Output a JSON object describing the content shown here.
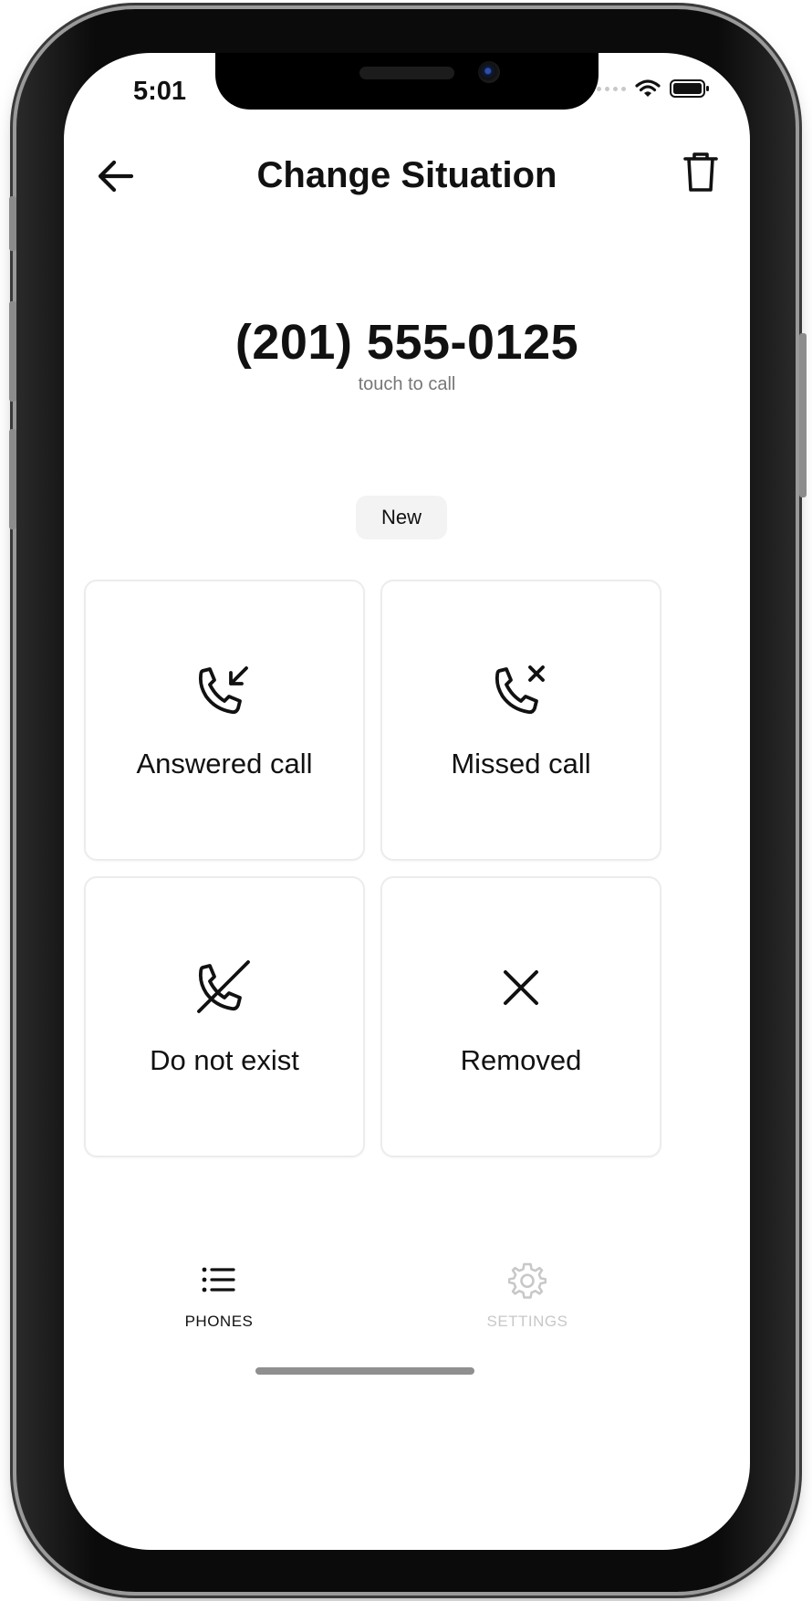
{
  "status": {
    "time": "5:01"
  },
  "header": {
    "title": "Change Situation"
  },
  "contact": {
    "phone": "(201) 555-0125",
    "hint": "touch to call",
    "badge": "New"
  },
  "options": [
    {
      "label": "Answered call",
      "icon": "phone-incoming-icon"
    },
    {
      "label": "Missed call",
      "icon": "phone-missed-icon"
    },
    {
      "label": "Do not exist",
      "icon": "phone-off-icon"
    },
    {
      "label": "Removed",
      "icon": "close-icon"
    }
  ],
  "tabs": [
    {
      "label": "PHONES",
      "icon": "list-icon",
      "active": true
    },
    {
      "label": "SETTINGS",
      "icon": "gear-icon",
      "active": false
    }
  ],
  "colors": {
    "text": "#111111",
    "muted": "#777777",
    "inactive_tab": "#c8c8c8",
    "badge_bg": "#f3f3f3",
    "card_border": "#ececec"
  }
}
